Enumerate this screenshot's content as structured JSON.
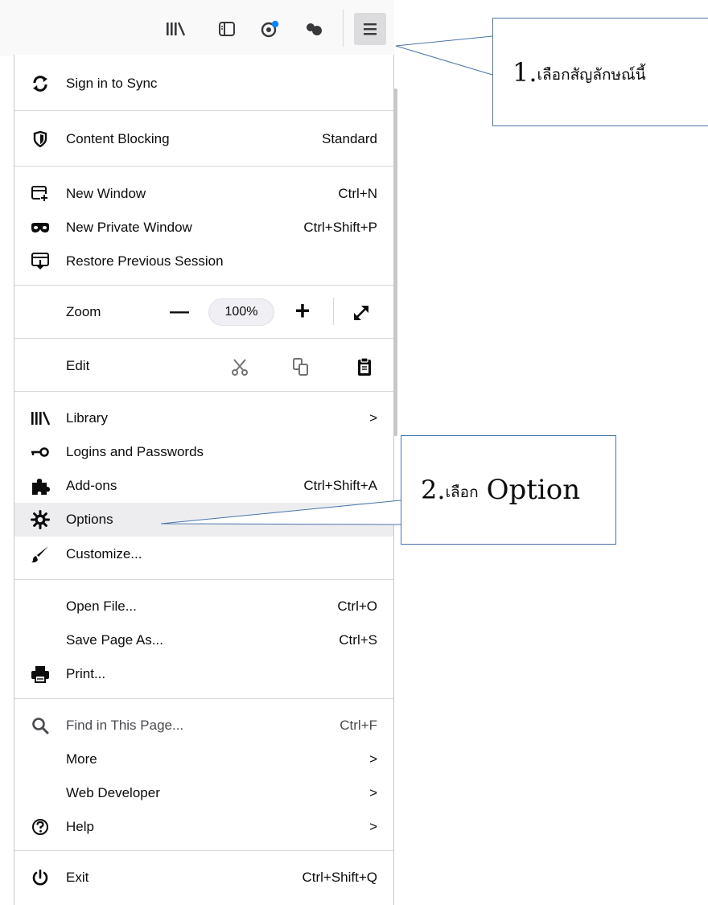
{
  "menu": {
    "sign_in": "Sign in to Sync",
    "content_blocking": {
      "label": "Content Blocking",
      "value": "Standard"
    },
    "new_window": {
      "label": "New Window",
      "shortcut": "Ctrl+N"
    },
    "new_private_window": {
      "label": "New Private Window",
      "shortcut": "Ctrl+Shift+P"
    },
    "restore_session": "Restore Previous Session",
    "zoom": {
      "label": "Zoom",
      "minus": "—",
      "value": "100%",
      "plus": "+"
    },
    "edit": "Edit",
    "library": {
      "label": "Library",
      "arrow": ">"
    },
    "logins": "Logins and Passwords",
    "addons": {
      "label": "Add-ons",
      "shortcut": "Ctrl+Shift+A"
    },
    "options": "Options",
    "customize": "Customize...",
    "open_file": {
      "label": "Open File...",
      "shortcut": "Ctrl+O"
    },
    "save_page": {
      "label": "Save Page As...",
      "shortcut": "Ctrl+S"
    },
    "print": "Print...",
    "find": {
      "label": "Find in This Page...",
      "shortcut": "Ctrl+F"
    },
    "more": {
      "label": "More",
      "arrow": ">"
    },
    "web_developer": {
      "label": "Web Developer",
      "arrow": ">"
    },
    "help": {
      "label": "Help",
      "arrow": ">"
    },
    "exit": {
      "label": "Exit",
      "shortcut": "Ctrl+Shift+Q"
    }
  },
  "callouts": {
    "one": {
      "num": "1.",
      "text": "เลือกสัญลักษณ์นี้"
    },
    "two": {
      "num": "2.",
      "thai": "เลือก",
      "text": "Option"
    }
  },
  "icons": [
    "library-icon",
    "sidebar-icon",
    "account-icon",
    "extension-icon",
    "hamburger-menu-icon"
  ],
  "colors": {
    "highlight": "#ededf0",
    "callout_border": "#4a74a8",
    "separator": "#d7d7db"
  }
}
